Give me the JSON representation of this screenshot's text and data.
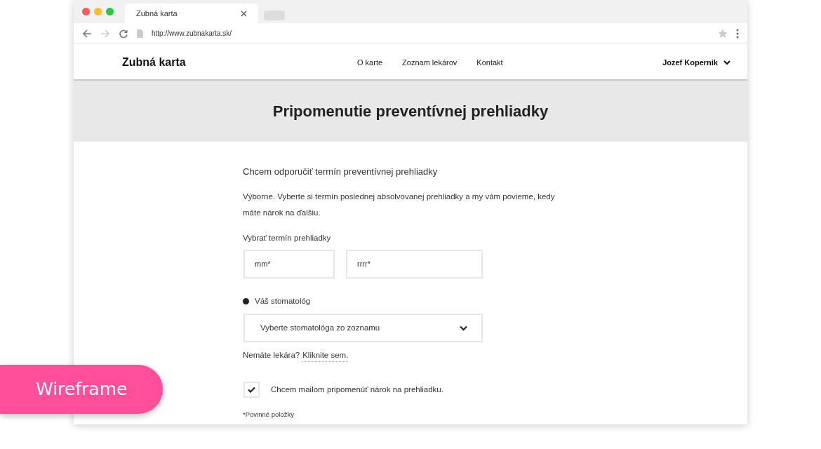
{
  "browser": {
    "tab_title": "Zubná karta",
    "url": "http://www.zubnakarta.sk/"
  },
  "site": {
    "logo": "Zubná karta",
    "nav": [
      {
        "label": "O karte"
      },
      {
        "label": "Zoznam lekárov"
      },
      {
        "label": "Kontakt"
      }
    ],
    "user": "Jozef Kopernik"
  },
  "hero": {
    "title": "Pripomenutie preventívnej prehliadky"
  },
  "form": {
    "heading": "Chcem odporučiť termín preventívnej prehliadky",
    "intro": "Výborne. Vyberte si termín poslednej absolvovanej prehliadky a my vám povieme, kedy máte nárok na ďalšiu.",
    "date_label": "Vybrať termín prehliadky",
    "date_fields": [
      {
        "placeholder": "mm*"
      },
      {
        "placeholder": "rrrr*"
      }
    ],
    "dentist_label": "Váš stomatológ",
    "dentist_select": "Vyberte stomatológa zo zoznamu",
    "no_doctor": "Nemáte lekára?",
    "no_doctor_link": "Kliknite sem.",
    "reminder": {
      "label": "Chcem mailom pripomenúť nárok na prehliadku.",
      "checked": true
    },
    "required_note": "*Povinné položky"
  },
  "badge": "Wireframe"
}
